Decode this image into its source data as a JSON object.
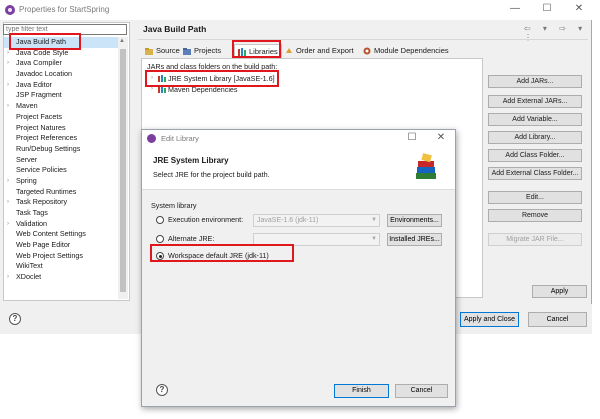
{
  "window": {
    "title": "Properties for StartSpring",
    "controls": {
      "minimize": "—",
      "maximize": "☐",
      "close": "✕"
    }
  },
  "filter": {
    "placeholder": "type filter text"
  },
  "tree": {
    "items": [
      {
        "label": "Java Build Path",
        "expandable": false,
        "selected": true
      },
      {
        "label": "Java Code Style",
        "expandable": true
      },
      {
        "label": "Java Compiler",
        "expandable": true
      },
      {
        "label": "Javadoc Location",
        "expandable": false
      },
      {
        "label": "Java Editor",
        "expandable": true
      },
      {
        "label": "JSP Fragment",
        "expandable": false
      },
      {
        "label": "Maven",
        "expandable": true
      },
      {
        "label": "Project Facets",
        "expandable": false
      },
      {
        "label": "Project Natures",
        "expandable": false
      },
      {
        "label": "Project References",
        "expandable": false
      },
      {
        "label": "Run/Debug Settings",
        "expandable": false
      },
      {
        "label": "Server",
        "expandable": false
      },
      {
        "label": "Service Policies",
        "expandable": false
      },
      {
        "label": "Spring",
        "expandable": true
      },
      {
        "label": "Targeted Runtimes",
        "expandable": false
      },
      {
        "label": "Task Repository",
        "expandable": true
      },
      {
        "label": "Task Tags",
        "expandable": false
      },
      {
        "label": "Validation",
        "expandable": true
      },
      {
        "label": "Web Content Settings",
        "expandable": false
      },
      {
        "label": "Web Page Editor",
        "expandable": false
      },
      {
        "label": "Web Project Settings",
        "expandable": false
      },
      {
        "label": "WikiText",
        "expandable": false
      },
      {
        "label": "XDoclet",
        "expandable": true
      }
    ]
  },
  "panel": {
    "title": "Java Build Path",
    "nav_icons": "⇦ ▾ ⇨ ▾ ⋮",
    "tabs": [
      {
        "label": "Source",
        "icon": "source-folder-icon",
        "active": false
      },
      {
        "label": "Projects",
        "icon": "projects-icon",
        "active": false
      },
      {
        "label": "Libraries",
        "icon": "libraries-icon",
        "active": true
      },
      {
        "label": "Order and Export",
        "icon": "order-export-icon",
        "active": false
      },
      {
        "label": "Module Dependencies",
        "icon": "module-icon",
        "active": false
      }
    ],
    "caption": "JARs and class folders on the build path:",
    "libraries": [
      {
        "label": "JRE System Library [JavaSE-1.6]"
      },
      {
        "label": "Maven Dependencies"
      }
    ],
    "buttons": [
      {
        "label": "Add JARs...",
        "enabled": true
      },
      {
        "label": "Add External JARs...",
        "enabled": true
      },
      {
        "label": "Add Variable...",
        "enabled": true
      },
      {
        "label": "Add Library...",
        "enabled": true
      },
      {
        "label": "Add Class Folder...",
        "enabled": true
      },
      {
        "label": "Add External Class Folder...",
        "enabled": true
      },
      {
        "label": "Edit...",
        "enabled": true
      },
      {
        "label": "Remove",
        "enabled": true
      },
      {
        "label": "Migrate JAR File...",
        "enabled": false
      }
    ],
    "apply_label": "Apply"
  },
  "footer": {
    "help": "?",
    "apply_close_label": "Apply and Close",
    "cancel_label": "Cancel"
  },
  "dialog": {
    "title": "Edit Library",
    "controls": {
      "maximize": "☐",
      "close": "✕"
    },
    "heading": "JRE System Library",
    "description": "Select JRE for the project build path.",
    "group_label": "System library",
    "options": [
      {
        "label": "Execution environment:",
        "selected": false,
        "combo_value": "JavaSE-1.6 (jdk-11)",
        "button": "Environments..."
      },
      {
        "label": "Alternate JRE:",
        "selected": false,
        "combo_value": "",
        "button": "Installed JREs..."
      },
      {
        "label": "Workspace default JRE (jdk-11)",
        "selected": true
      }
    ],
    "help": "?",
    "finish_label": "Finish",
    "cancel_label": "Cancel"
  },
  "colors": {
    "annotation": "#e0181d",
    "selection": "#cce4f7",
    "brand": "#7b3fa0",
    "default_button_border": "#0078d7"
  }
}
